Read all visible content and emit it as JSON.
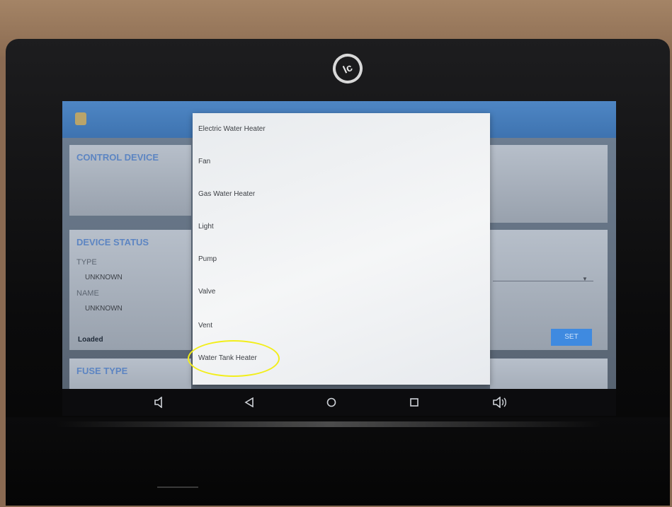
{
  "brand": {
    "logo_text": "lc"
  },
  "app": {
    "header_title_line1": "",
    "header_title_line2": "",
    "control_device_title": "CONTROL DEVICE",
    "device_status_title": "DEVICE STATUS",
    "type_label": "TYPE",
    "type_value": "UNKNOWN",
    "name_label": "NAME",
    "name_value": "UNKNOWN",
    "status_text": "Loaded",
    "fuse_type_title": "FUSE TYPE",
    "set_button_label": "SET"
  },
  "dropdown": {
    "options": [
      "Electric Water Heater",
      "Fan",
      "Gas Water Heater",
      "Light",
      "Pump",
      "Valve",
      "Vent",
      "Water Tank Heater"
    ],
    "circled_option": "Water Tank Heater",
    "circle_color": "#f2ee1b"
  },
  "navbar": {
    "icons": [
      "volume-down-icon",
      "back-icon",
      "home-icon",
      "recent-apps-icon",
      "volume-up-icon"
    ]
  },
  "colors": {
    "appbar": "#4e86c4",
    "accent": "#3f8ae0",
    "highlight": "#f2ee1b"
  }
}
